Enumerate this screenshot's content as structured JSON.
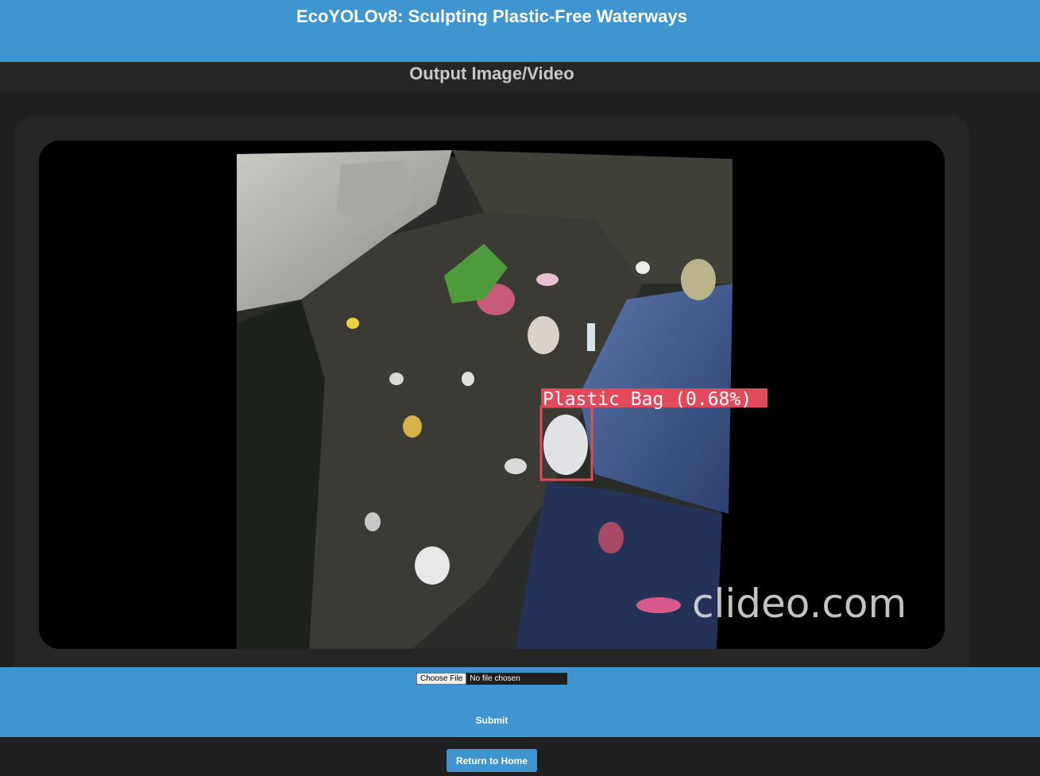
{
  "header": {
    "title": "EcoYOLOv8: Sculpting Plastic-Free Waterways"
  },
  "output": {
    "heading": "Output Image/Video"
  },
  "viewer": {
    "detection": {
      "label": "Plastic Bag (0.68%)",
      "color": "#e04a5a"
    },
    "watermark": "clideo.com"
  },
  "form": {
    "file_button": "Choose File",
    "file_status": "No file chosen",
    "submit_label": "Submit"
  },
  "footer": {
    "home_label": "Return to Home"
  },
  "colors": {
    "accent": "#3e95d0",
    "background": "#1f1f1f",
    "panel": "#262626"
  }
}
